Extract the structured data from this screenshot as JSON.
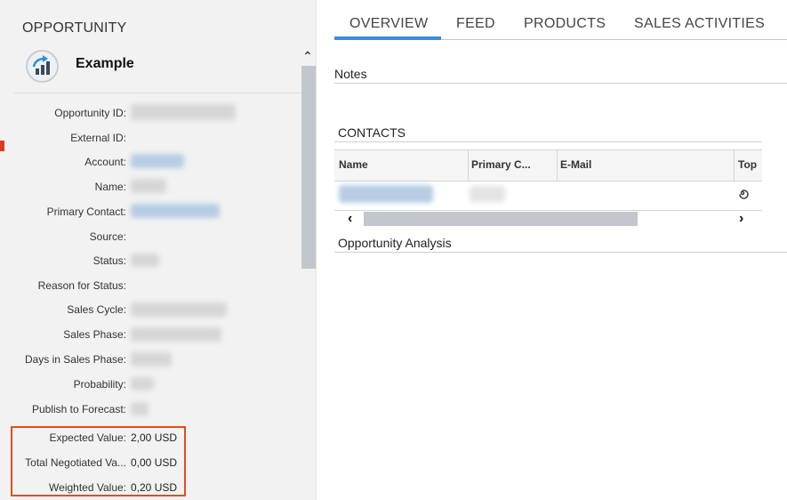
{
  "left": {
    "header": "OPPORTUNITY",
    "object_name": "Example",
    "icon": "opportunity-chart-icon",
    "collapse_icon": "chevron-up-icon",
    "fields": [
      {
        "label": "Opportunity ID:",
        "value": ""
      },
      {
        "label": "External ID:",
        "value": ""
      },
      {
        "label": "Account:",
        "value": ""
      },
      {
        "label": "Name:",
        "value": ""
      },
      {
        "label": "Primary Contact:",
        "value": ""
      },
      {
        "label": "Source:",
        "value": ""
      },
      {
        "label": "Status:",
        "value": ""
      },
      {
        "label": "Reason for Status:",
        "value": ""
      },
      {
        "label": "Sales Cycle:",
        "value": ""
      },
      {
        "label": "Sales Phase:",
        "value": ""
      },
      {
        "label": "Days in Sales Phase:",
        "value": ""
      },
      {
        "label": "Probability:",
        "value": ""
      },
      {
        "label": "Publish to Forecast:",
        "value": ""
      },
      {
        "label": "Expected Value:",
        "value": "2,00 USD"
      },
      {
        "label": "Total Negotiated Va...",
        "value": "0,00 USD"
      },
      {
        "label": "Weighted Value:",
        "value": "0,20 USD"
      }
    ]
  },
  "tabs": [
    {
      "label": "OVERVIEW",
      "active": true
    },
    {
      "label": "FEED",
      "active": false
    },
    {
      "label": "PRODUCTS",
      "active": false
    },
    {
      "label": "SALES ACTIVITIES",
      "active": false
    }
  ],
  "sections": {
    "notes": "Notes",
    "contacts": "CONTACTS",
    "analysis": "Opportunity Analysis"
  },
  "contacts_table": {
    "columns": [
      "Name",
      "Primary C...",
      "E-Mail",
      "Top"
    ],
    "rows": [
      {
        "name": "",
        "primary": "",
        "email": "",
        "top_icon": "swirl-icon"
      }
    ]
  },
  "colors": {
    "accent": "#3a8edc",
    "highlight": "#e0501e",
    "panel_bg": "#f2f2f2"
  }
}
